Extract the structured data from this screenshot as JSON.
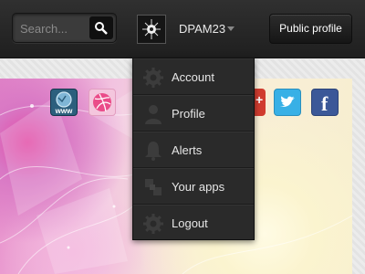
{
  "search": {
    "placeholder": "Search..."
  },
  "user": {
    "name": "DPAM23"
  },
  "header": {
    "public_profile_label": "Public profile"
  },
  "menu": {
    "items": [
      {
        "label": "Account",
        "icon": "gear-icon"
      },
      {
        "label": "Profile",
        "icon": "person-icon"
      },
      {
        "label": "Alerts",
        "icon": "bell-icon"
      },
      {
        "label": "Your apps",
        "icon": "apps-icon"
      },
      {
        "label": "Logout",
        "icon": "gear-icon"
      }
    ]
  },
  "social": {
    "icons": [
      "www-icon",
      "dribbble-icon",
      "google-plus-icon",
      "twitter-icon",
      "facebook-icon"
    ]
  },
  "colors": {
    "topbar": "#252525",
    "menu_bg": "#2a2a2a",
    "twitter": "#38b0e6",
    "facebook": "#3b5898",
    "google": "#d13c2f"
  }
}
